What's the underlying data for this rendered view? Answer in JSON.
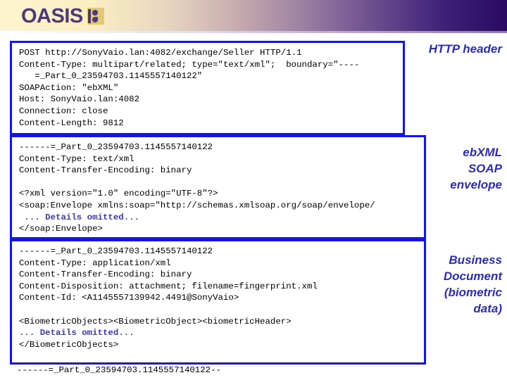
{
  "header": {
    "logo_text": "OASIS",
    "logo_mark_name": "oasis-mark"
  },
  "boxes": [
    {
      "id": "http-header",
      "label": "HTTP header",
      "lines": [
        {
          "text": "POST http://SonyVaio.lan:4082/exchange/Seller HTTP/1.1",
          "style": "plain"
        },
        {
          "text": "Content-Type: multipart/related; type=\"text/xml\";  boundary=\"----",
          "style": "plain"
        },
        {
          "text": "   =_Part_0_23594703.1145557140122\"",
          "style": "plain"
        },
        {
          "text": "SOAPAction: \"ebXML\"",
          "style": "plain"
        },
        {
          "text": "Host: SonyVaio.lan:4082",
          "style": "plain"
        },
        {
          "text": "Connection: close",
          "style": "plain"
        },
        {
          "text": "Content-Length: 9812",
          "style": "plain"
        }
      ]
    },
    {
      "id": "soap",
      "label": "ebXML\nSOAP\nenvelope",
      "lines": [
        {
          "text": "------=_Part_0_23594703.1145557140122",
          "style": "plain"
        },
        {
          "text": "Content-Type: text/xml",
          "style": "plain"
        },
        {
          "text": "Content-Transfer-Encoding: binary",
          "style": "plain"
        },
        {
          "text": "",
          "style": "blank"
        },
        {
          "text": "<?xml version=\"1.0\" encoding=\"UTF-8\"?>",
          "style": "plain"
        },
        {
          "text": "<soap:Envelope xmlns:soap=\"http://schemas.xmlsoap.org/soap/envelope/",
          "style": "plain"
        },
        {
          "text": " ... Details omitted...",
          "style": "omitted"
        },
        {
          "text": "</soap:Envelope>",
          "style": "plain"
        }
      ]
    },
    {
      "id": "business-doc",
      "label": "Business\nDocument\n(biometric\ndata)",
      "lines": [
        {
          "text": "------=_Part_0_23594703.1145557140122",
          "style": "plain"
        },
        {
          "text": "Content-Type: application/xml",
          "style": "plain"
        },
        {
          "text": "Content-Transfer-Encoding: binary",
          "style": "plain"
        },
        {
          "text": "Content-Disposition: attachment; filename=fingerprint.xml",
          "style": "plain"
        },
        {
          "text": "Content-Id: <A1145557139942.4491@SonyVaio>",
          "style": "plain"
        },
        {
          "text": "",
          "style": "blank"
        },
        {
          "text": "<BiometricObjects><BiometricObject><biometricHeader>",
          "style": "plain"
        },
        {
          "text": "... Details omitted...",
          "style": "omitted"
        },
        {
          "text": "</BiometricObjects>",
          "style": "plain"
        }
      ]
    }
  ],
  "trailing_boundary": "------=_Part_0_23594703.1145557140122--",
  "colors": {
    "box_border": "#1414e6",
    "annotation_text": "#2b2bbe",
    "omitted_text": "#3a3ab0",
    "logo_purple": "#4b3a76",
    "logo_gold": "#e3c873"
  }
}
